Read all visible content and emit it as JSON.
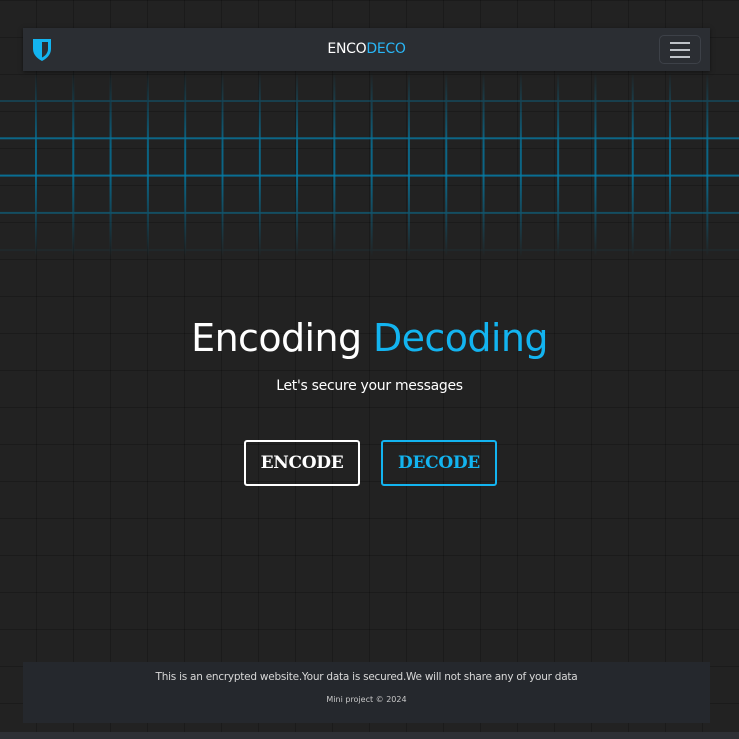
{
  "navbar": {
    "logo_icon": "shield-icon",
    "brand_part1": "ENCO",
    "brand_part2": "DECO",
    "menu_icon": "hamburger-menu-icon"
  },
  "hero": {
    "title_part1": "Encoding",
    "title_part2": "Decoding",
    "subtitle": "Let's secure your messages"
  },
  "actions": {
    "encode_label": "ENCODE",
    "decode_label": "DECODE"
  },
  "footer": {
    "notice": "This is an encrypted website.Your data is secured.We will not share any of your data",
    "copyright": "Mini project © 2024"
  },
  "colors": {
    "background": "#222222",
    "navbar": "#2b2e33",
    "accent": "#13b4f0",
    "grid_glow": "#008cbe",
    "footer": "#25282d"
  }
}
